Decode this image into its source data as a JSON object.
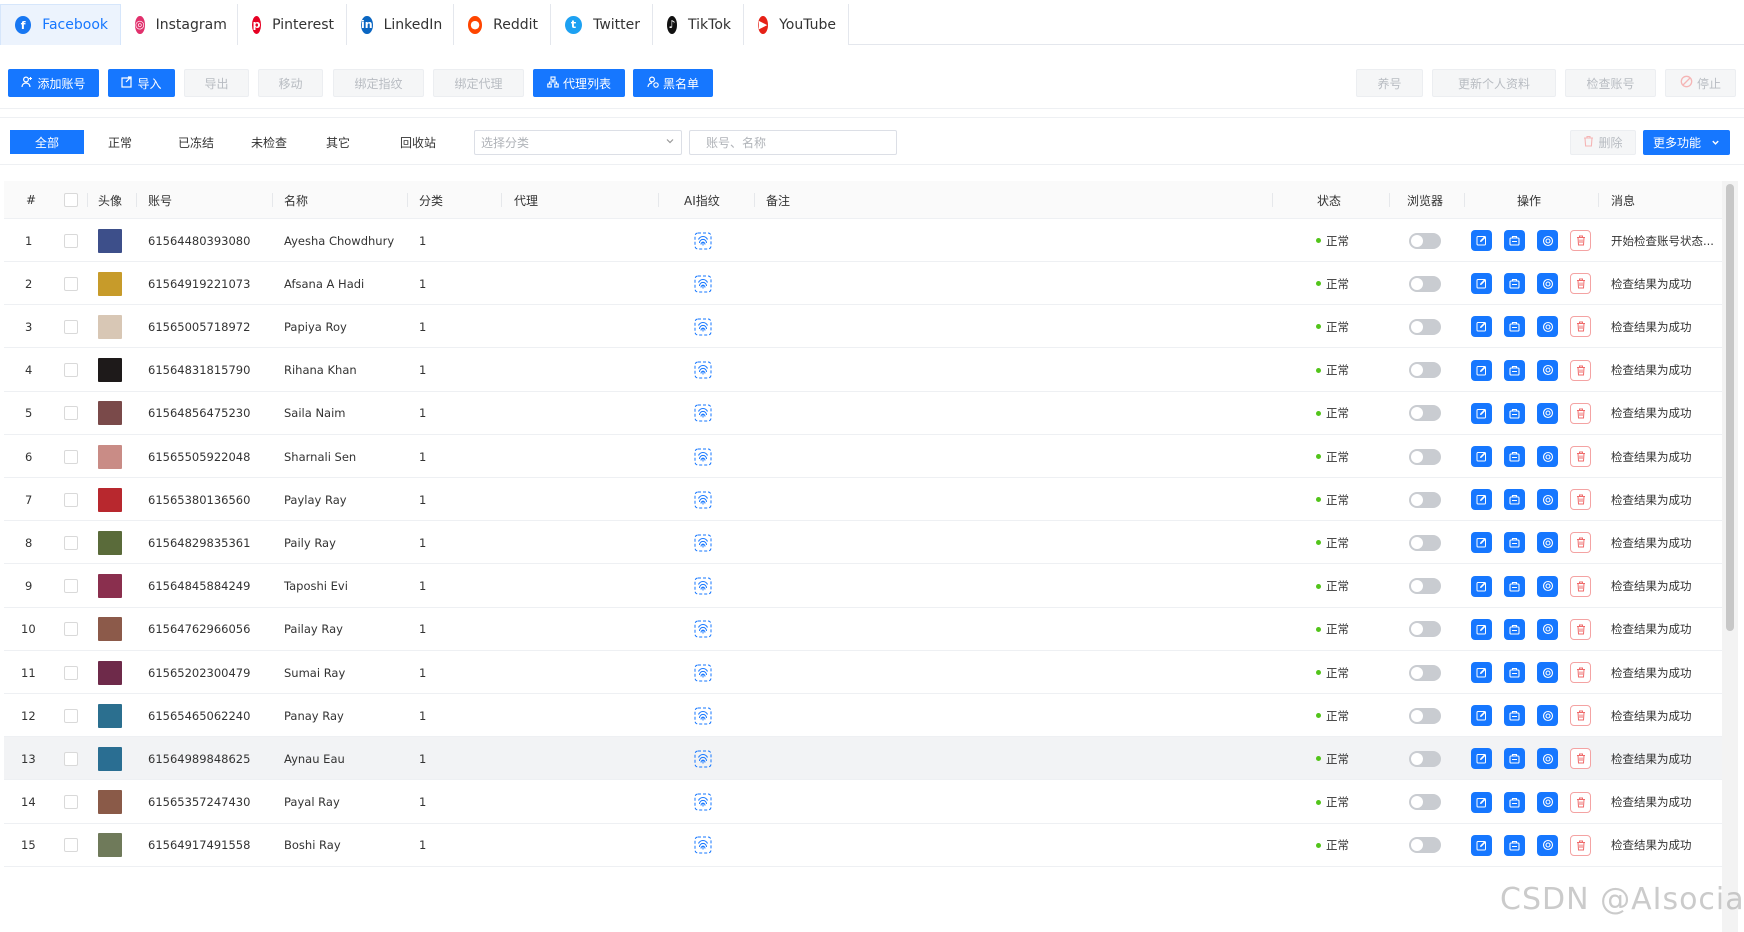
{
  "platform_tabs": [
    {
      "label": "Facebook",
      "icon": "facebook-icon",
      "color": "#1877f2",
      "glyph": "f",
      "active": true
    },
    {
      "label": "Instagram",
      "icon": "instagram-icon",
      "color": "#e1306c",
      "glyph": "◎",
      "active": false
    },
    {
      "label": "Pinterest",
      "icon": "pinterest-icon",
      "color": "#e60023",
      "glyph": "p",
      "active": false
    },
    {
      "label": "LinkedIn",
      "icon": "linkedin-icon",
      "color": "#0a66c2",
      "glyph": "in",
      "active": false
    },
    {
      "label": "Reddit",
      "icon": "reddit-icon",
      "color": "#ff4500",
      "glyph": "●",
      "active": false
    },
    {
      "label": "Twitter",
      "icon": "twitter-icon",
      "color": "#1da1f2",
      "glyph": "t",
      "active": false
    },
    {
      "label": "TikTok",
      "icon": "tiktok-icon",
      "color": "#111111",
      "glyph": "♪",
      "active": false
    },
    {
      "label": "YouTube",
      "icon": "youtube-icon",
      "color": "#e62117",
      "glyph": "▶",
      "active": false
    }
  ],
  "toolbar": {
    "add_account": "添加账号",
    "import": "导入",
    "export": "导出",
    "move": "移动",
    "bind_fingerprint": "绑定指纹",
    "bind_proxy": "绑定代理",
    "proxy_list": "代理列表",
    "blacklist": "黑名单",
    "nurture": "养号",
    "update_profile": "更新个人资料",
    "check_account": "检查账号",
    "stop": "停止"
  },
  "filter": {
    "tabs": [
      "全部",
      "正常",
      "已冻结",
      "未检查",
      "其它",
      "回收站"
    ],
    "active_tab": "全部",
    "category_placeholder": "选择分类",
    "search_placeholder": "账号、名称",
    "delete": "删除",
    "more": "更多功能"
  },
  "table": {
    "headers": {
      "index": "#",
      "avatar": "头像",
      "account": "账号",
      "name": "名称",
      "category": "分类",
      "proxy": "代理",
      "fingerprint": "AI指纹",
      "note": "备注",
      "status": "状态",
      "browser": "浏览器",
      "actions": "操作",
      "message": "消息"
    },
    "rows": [
      {
        "index": "1",
        "account": "61564480393080",
        "name": "Ayesha Chowdhury",
        "category": "1",
        "status": "正常",
        "message": "开始检查账号状态...",
        "avatar_color": "#3d4f8a"
      },
      {
        "index": "2",
        "account": "61564919221073",
        "name": "Afsana A Hadi",
        "category": "1",
        "status": "正常",
        "message": "检查结果为成功",
        "avatar_color": "#c79b2a"
      },
      {
        "index": "3",
        "account": "61565005718972",
        "name": "Papiya Roy",
        "category": "1",
        "status": "正常",
        "message": "检查结果为成功",
        "avatar_color": "#d8c7b5"
      },
      {
        "index": "4",
        "account": "61564831815790",
        "name": "Rihana Khan",
        "category": "1",
        "status": "正常",
        "message": "检查结果为成功",
        "avatar_color": "#1e1a1a"
      },
      {
        "index": "5",
        "account": "61564856475230",
        "name": "Saila Naim",
        "category": "1",
        "status": "正常",
        "message": "检查结果为成功",
        "avatar_color": "#7a4a4a"
      },
      {
        "index": "6",
        "account": "61565505922048",
        "name": "Sharnali Sen",
        "category": "1",
        "status": "正常",
        "message": "检查结果为成功",
        "avatar_color": "#c98c86"
      },
      {
        "index": "7",
        "account": "61565380136560",
        "name": "Paylay Ray",
        "category": "1",
        "status": "正常",
        "message": "检查结果为成功",
        "avatar_color": "#b8282e"
      },
      {
        "index": "8",
        "account": "61564829835361",
        "name": "Paily Ray",
        "category": "1",
        "status": "正常",
        "message": "检查结果为成功",
        "avatar_color": "#5a6b3a"
      },
      {
        "index": "9",
        "account": "61564845884249",
        "name": "Taposhi Evi",
        "category": "1",
        "status": "正常",
        "message": "检查结果为成功",
        "avatar_color": "#8a2f4e"
      },
      {
        "index": "10",
        "account": "61564762966056",
        "name": "Pailay Ray",
        "category": "1",
        "status": "正常",
        "message": "检查结果为成功",
        "avatar_color": "#8c5a4a"
      },
      {
        "index": "11",
        "account": "61565202300479",
        "name": "Sumai Ray",
        "category": "1",
        "status": "正常",
        "message": "检查结果为成功",
        "avatar_color": "#6e2a4a"
      },
      {
        "index": "12",
        "account": "61565465062240",
        "name": "Panay Ray",
        "category": "1",
        "status": "正常",
        "message": "检查结果为成功",
        "avatar_color": "#2b6f8f"
      },
      {
        "index": "13",
        "account": "61564989848625",
        "name": "Aynau Eau",
        "category": "1",
        "status": "正常",
        "message": "检查结果为成功",
        "avatar_color": "#2a6e92"
      },
      {
        "index": "14",
        "account": "61565357247430",
        "name": "Payal Ray",
        "category": "1",
        "status": "正常",
        "message": "检查结果为成功",
        "avatar_color": "#8a5a48"
      },
      {
        "index": "15",
        "account": "61564917491558",
        "name": "Boshi Ray",
        "category": "1",
        "status": "正常",
        "message": "检查结果为成功",
        "avatar_color": "#6f7a5a"
      }
    ]
  },
  "watermark": "CSDN @AIsocial"
}
